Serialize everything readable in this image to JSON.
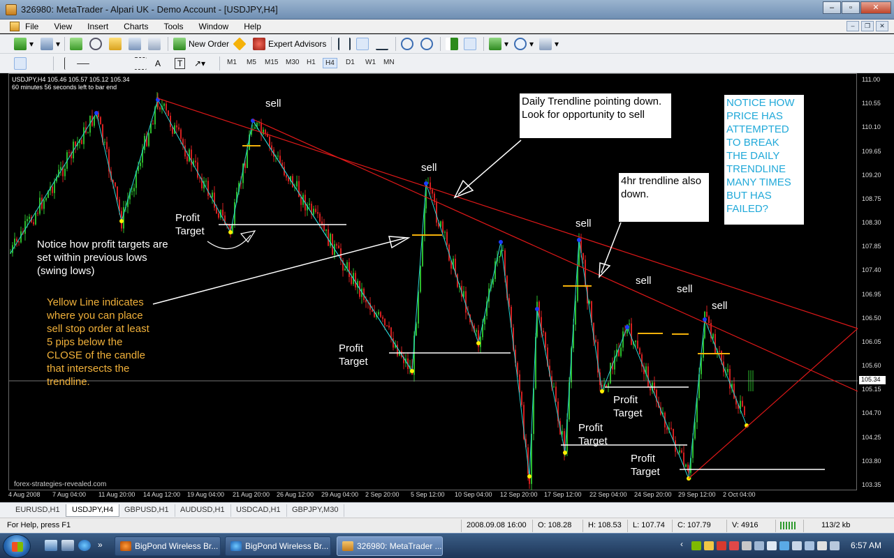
{
  "window": {
    "title": "326980: MetaTrader - Alpari UK - Demo Account - [USDJPY,H4]"
  },
  "menu": [
    "File",
    "View",
    "Insert",
    "Charts",
    "Tools",
    "Window",
    "Help"
  ],
  "toolbar": {
    "new_order": "New Order",
    "expert_advisors": "Expert Advisors"
  },
  "timeframes": [
    "M1",
    "M5",
    "M15",
    "M30",
    "H1",
    "H4",
    "D1",
    "W1",
    "MN"
  ],
  "active_timeframe": "H4",
  "chart": {
    "symbol_info": "USDJPY,H4  105.46 105.57 105.12 105.34",
    "countdown": "60 minutes 56 seconds left to bar end",
    "watermark": "forex-strategies-revealed.com",
    "current_price": "105.34",
    "price_ticks": [
      "111.00",
      "110.55",
      "110.10",
      "109.65",
      "109.20",
      "108.75",
      "108.30",
      "107.85",
      "107.40",
      "106.95",
      "106.50",
      "106.05",
      "105.60",
      "105.15",
      "104.70",
      "104.25",
      "103.80",
      "103.35"
    ],
    "time_ticks": [
      "4 Aug 2008",
      "7 Aug 04:00",
      "11 Aug 20:00",
      "14 Aug 12:00",
      "19 Aug 04:00",
      "21 Aug 20:00",
      "26 Aug 12:00",
      "29 Aug 04:00",
      "2 Sep 20:00",
      "5 Sep 12:00",
      "10 Sep 04:00",
      "12 Sep 20:00",
      "17 Sep 12:00",
      "22 Sep 04:00",
      "24 Sep 20:00",
      "29 Sep 12:00",
      "2 Oct 04:00"
    ],
    "annotations": {
      "daily_trendline": "Daily Trendline pointing down. Look for opportunity to sell",
      "fourhr_trendline": "4hr trendline also down.",
      "notice_break": "NOTICE HOW PRICE HAS ATTEMPTED TO BREAK THE DAILY TRENDLINE MANY TIMES BUT HAS FAILED?",
      "profit_targets_note": "Notice how profit targets are set within previous lows (swing lows)",
      "yellow_line_note": "Yellow Line indicates where you can place sell stop order at least 5 pips below the CLOSE of the candle that intersects the trendline.",
      "sell": "sell",
      "profit": "Profit",
      "target": "Target"
    }
  },
  "tabs": [
    "EURUSD,H1",
    "USDJPY,H4",
    "GBPUSD,H1",
    "AUDUSD,H1",
    "USDCAD,H1",
    "GBPJPY,M30"
  ],
  "active_tab": "USDJPY,H4",
  "status": {
    "help": "For Help, press F1",
    "datetime": "2008.09.08 16:00",
    "open": "O: 108.28",
    "high": "H: 108.53",
    "low": "L: 107.74",
    "close": "C: 107.79",
    "volume": "V: 4916",
    "traffic": "113/2 kb"
  },
  "taskbar": {
    "items": [
      "BigPond Wireless Br...",
      "BigPond Wireless Br...",
      "326980: MetaTrader ..."
    ],
    "clock": "6:57 AM"
  },
  "colors": {
    "candle_up": "#2dbb2d",
    "candle_down": "#d42020",
    "zigzag": "#2bd6d6",
    "trendline": "#e01818",
    "entry_line": "#f5b20a"
  }
}
